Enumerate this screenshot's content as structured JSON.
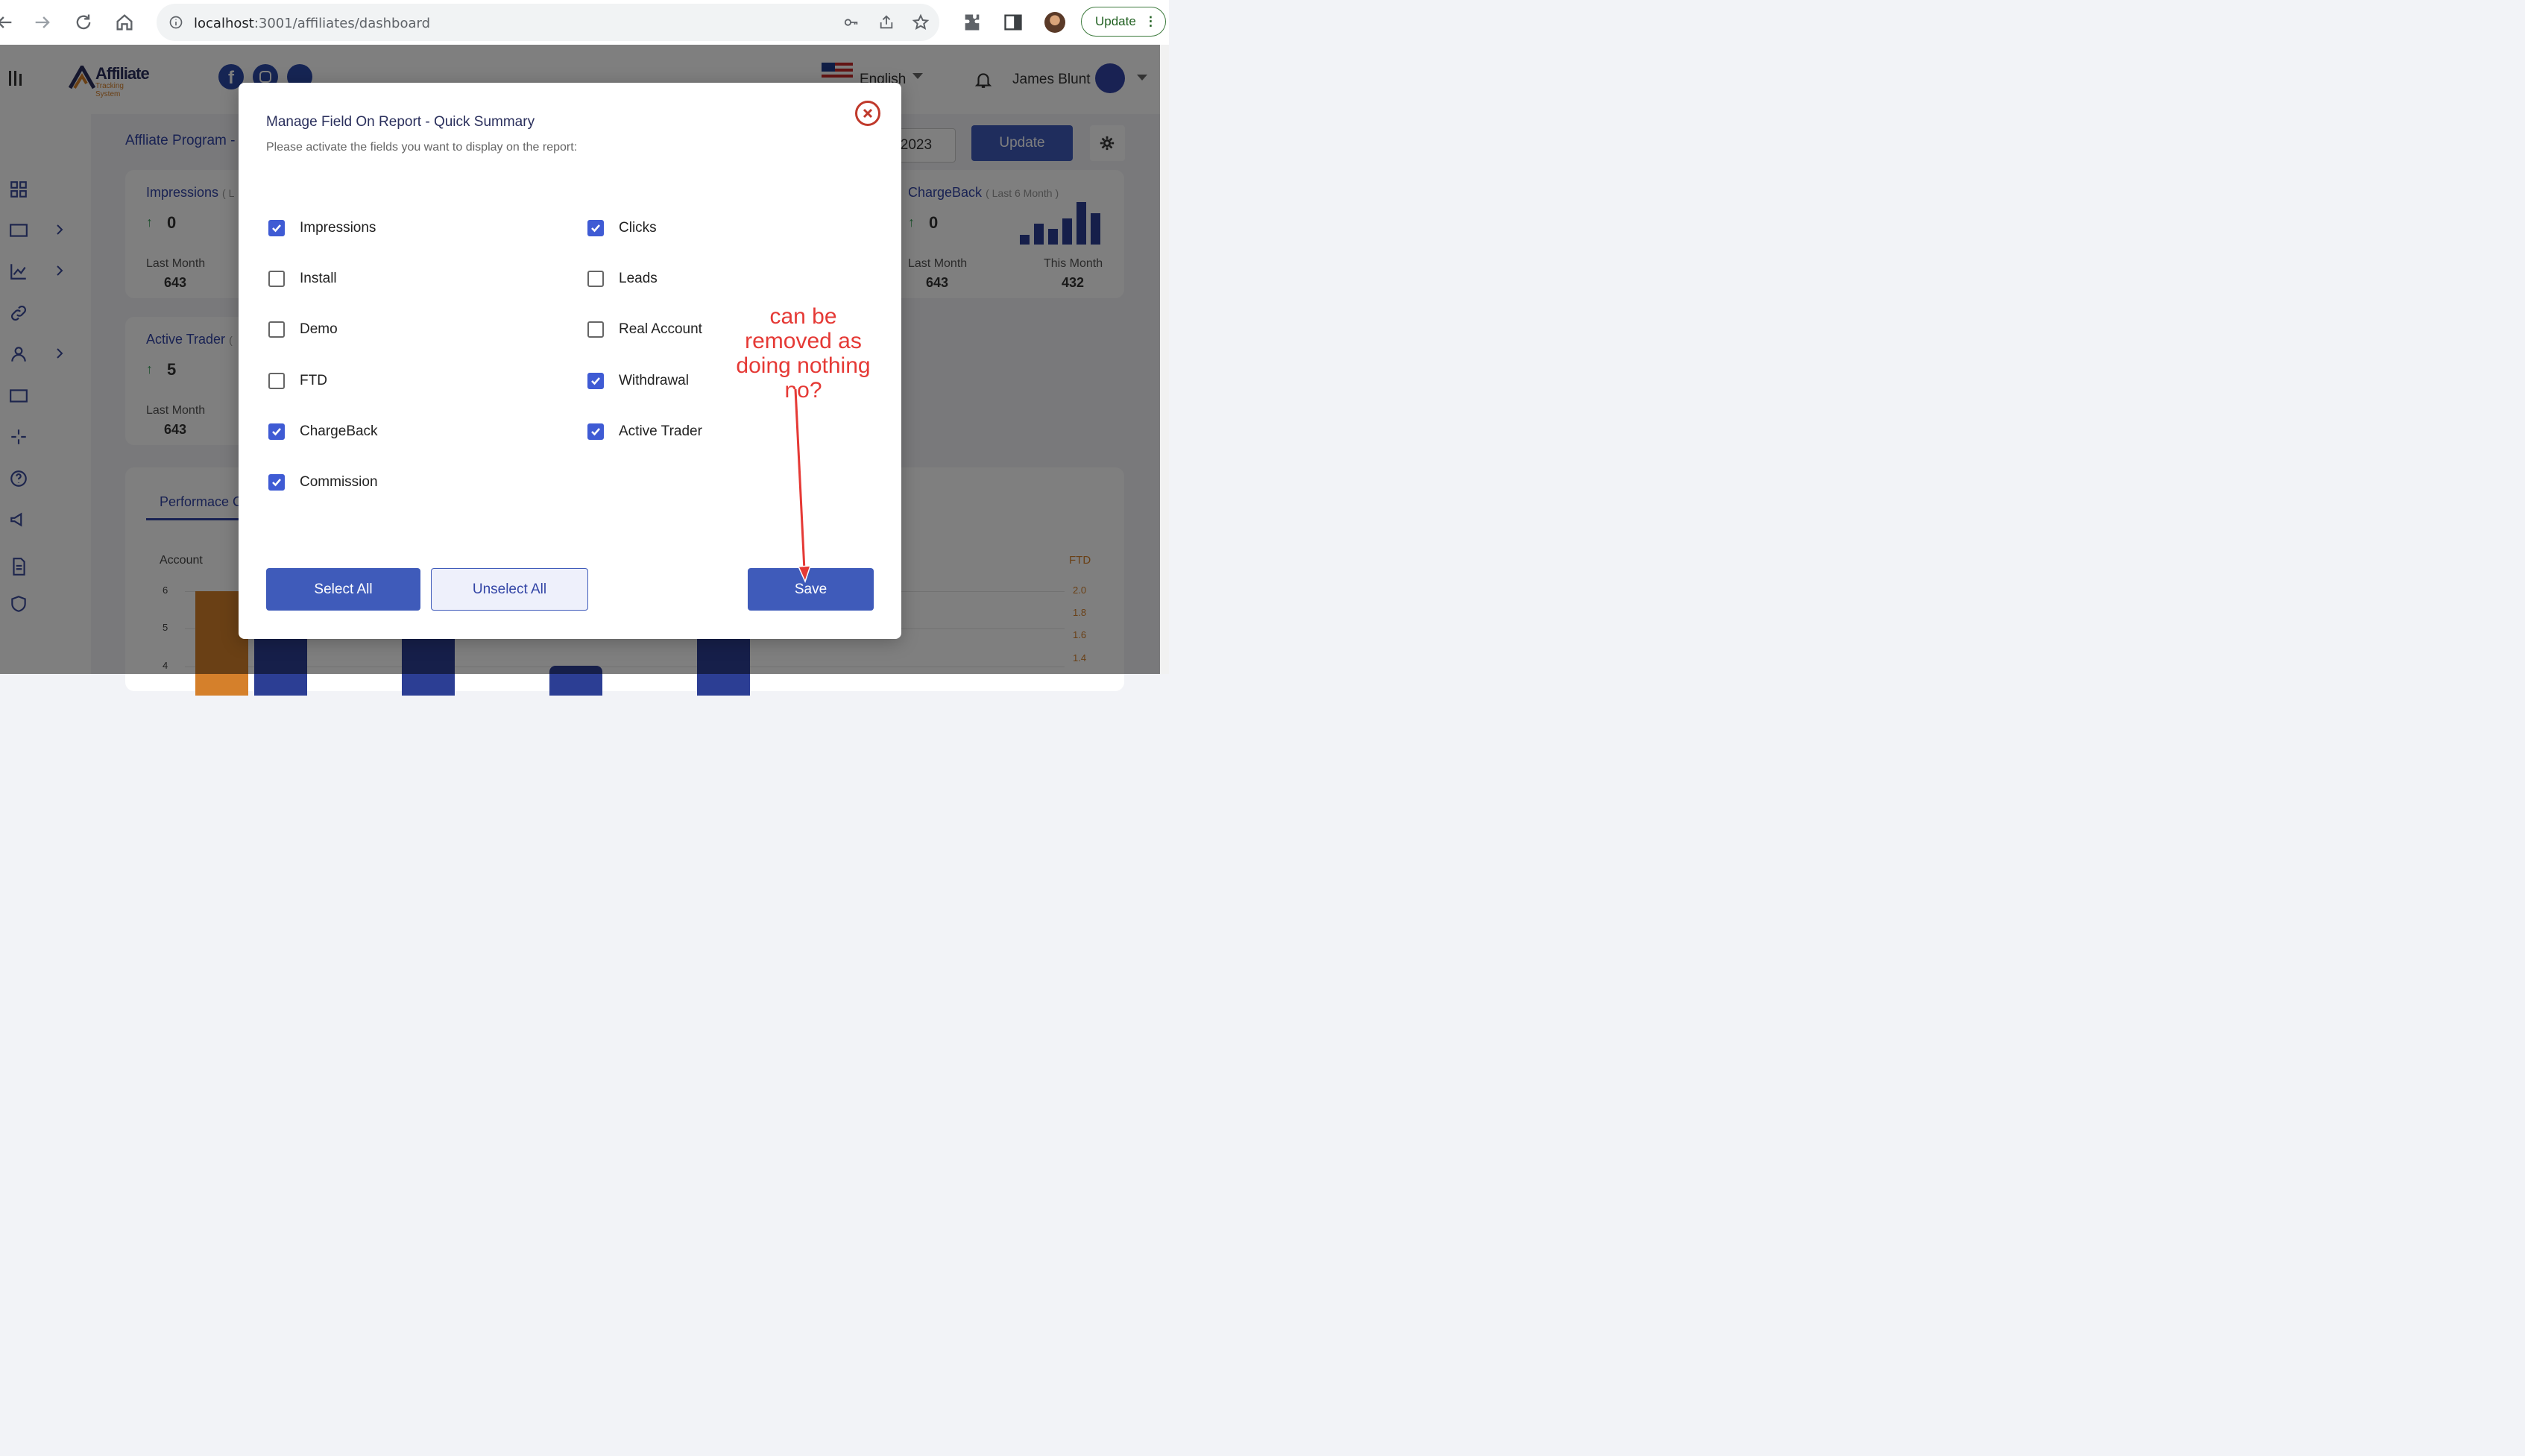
{
  "browser": {
    "url_host": "localhost",
    "url_rest": ":3001/affiliates/dashboard",
    "update_label": "Update"
  },
  "header": {
    "logo_main": "Affiliate",
    "logo_sub": "Tracking System",
    "language": "English",
    "user_name": "James Blunt"
  },
  "page": {
    "title_partial": "Affliate Program -",
    "date_partial": "y 2023",
    "update_button": "Update"
  },
  "cards": {
    "impressions": {
      "title": "Impressions",
      "sub": "( L",
      "value": "0",
      "last_month_label": "Last Month",
      "last_month_value": "643"
    },
    "active_trader": {
      "title": "Active Trader",
      "sub": "(",
      "value": "5",
      "last_month_label": "Last Month",
      "last_month_value": "643"
    },
    "chargeback": {
      "title": "ChargeBack",
      "sub": "( Last 6 Month )",
      "value": "0",
      "last_month_label": "Last Month",
      "last_month_value": "643",
      "this_month_label": "This Month",
      "this_month_value": "432"
    }
  },
  "performance": {
    "tab_partial": "Performace C",
    "left_axis_label": "Account",
    "right_axis_label": "FTD",
    "left_ticks": [
      "6",
      "5",
      "4"
    ],
    "right_ticks": [
      "2.0",
      "1.8",
      "1.6",
      "1.4"
    ]
  },
  "modal": {
    "title": "Manage Field On Report - Quick Summary",
    "subtitle": "Please activate the fields you want to display on the report:",
    "fields": [
      {
        "label": "Impressions",
        "checked": true
      },
      {
        "label": "Clicks",
        "checked": true
      },
      {
        "label": "Install",
        "checked": false
      },
      {
        "label": "Leads",
        "checked": false
      },
      {
        "label": "Demo",
        "checked": false
      },
      {
        "label": "Real Account",
        "checked": false
      },
      {
        "label": "FTD",
        "checked": false
      },
      {
        "label": "Withdrawal",
        "checked": true
      },
      {
        "label": "ChargeBack",
        "checked": true
      },
      {
        "label": "Active Trader",
        "checked": true
      },
      {
        "label": "Commission",
        "checked": true
      }
    ],
    "select_all": "Select All",
    "unselect_all": "Unselect All",
    "save": "Save"
  },
  "annotation": {
    "lines": [
      "can be",
      "removed as",
      "doing nothing",
      "no?"
    ]
  },
  "colors": {
    "primary": "#3f5bba",
    "checkbox": "#3f5bd4",
    "annotation": "#e53935",
    "close": "#c0392b"
  }
}
